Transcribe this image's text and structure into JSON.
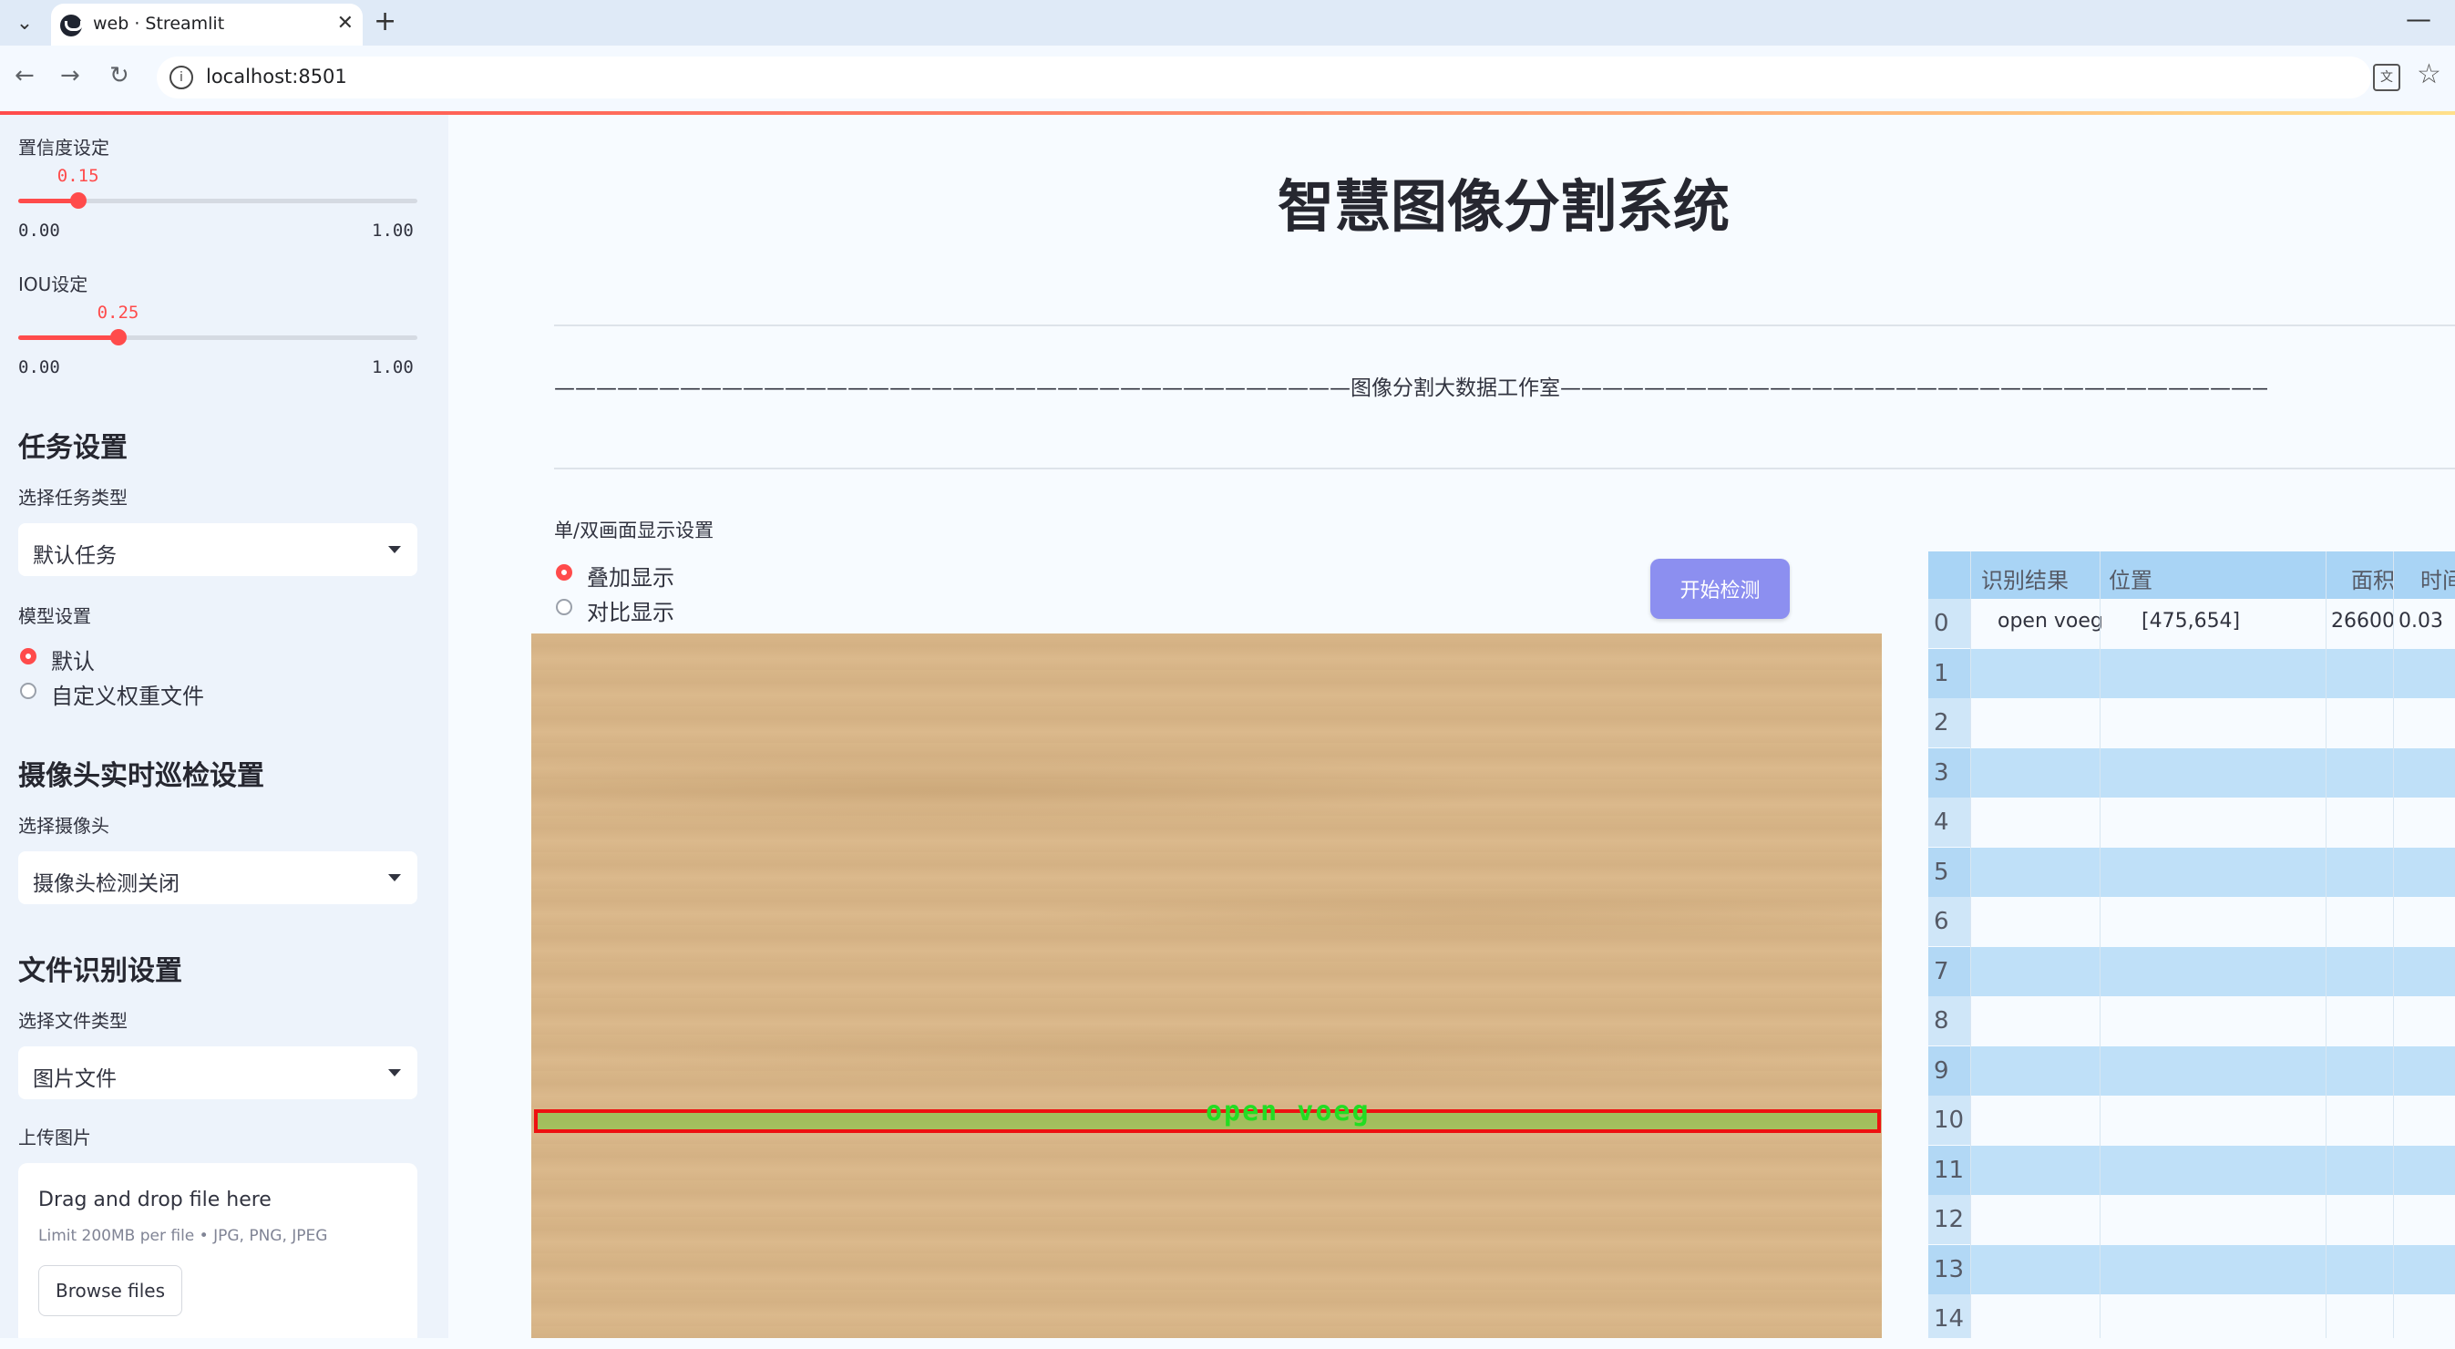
{
  "browser": {
    "tab_title": "web · Streamlit",
    "tab_close": "✕",
    "new_tab": "+",
    "minimize": "—",
    "url": "localhost:8501",
    "back": "←",
    "forward": "→",
    "reload": "↻"
  },
  "sidebar": {
    "confidence": {
      "label": "置信度设定",
      "value": "0.15",
      "value_num": 0.15,
      "min": "0.00",
      "max": "1.00"
    },
    "iou": {
      "label": "IOU设定",
      "value": "0.25",
      "value_num": 0.25,
      "min": "0.00",
      "max": "1.00"
    },
    "task_heading": "任务设置",
    "task_type_label": "选择任务类型",
    "task_type_value": "默认任务",
    "model_label": "模型设置",
    "model_options": [
      "默认",
      "自定义权重文件"
    ],
    "model_selected": 0,
    "camera_heading": "摄像头实时巡检设置",
    "camera_label": "选择摄像头",
    "camera_value": "摄像头检测关闭",
    "file_heading": "文件识别设置",
    "file_type_label": "选择文件类型",
    "file_type_value": "图片文件",
    "upload_label": "上传图片",
    "upload_title": "Drag and drop file here",
    "upload_limit": "Limit 200MB per file • JPG, PNG, JPEG",
    "browse_button": "Browse files"
  },
  "main": {
    "title": "智慧图像分割系统",
    "banner": "——————————————————————————————————————图像分割大数据工作室——————————————————————————————————————",
    "display_label": "单/双画面显示设置",
    "display_options": [
      "叠加显示",
      "对比显示"
    ],
    "display_selected": 0,
    "start_button": "开始检测",
    "detection_label": "open voeg"
  },
  "table": {
    "headers": [
      "识别结果",
      "位置",
      "面积",
      "时间"
    ],
    "rows": [
      {
        "idx": "0",
        "result": "open voeg",
        "position": "[475,654]",
        "area": "26600",
        "time": "0.03"
      },
      {
        "idx": "1"
      },
      {
        "idx": "2"
      },
      {
        "idx": "3"
      },
      {
        "idx": "4"
      },
      {
        "idx": "5"
      },
      {
        "idx": "6"
      },
      {
        "idx": "7"
      },
      {
        "idx": "8"
      },
      {
        "idx": "9"
      },
      {
        "idx": "10"
      },
      {
        "idx": "11"
      },
      {
        "idx": "12"
      },
      {
        "idx": "13"
      },
      {
        "idx": "14"
      }
    ]
  },
  "colors": {
    "accent": "#ff4b4b",
    "button": "#8c8ff0",
    "table_header": "#a9d4f5",
    "table_alt": "#bfe0f8"
  }
}
